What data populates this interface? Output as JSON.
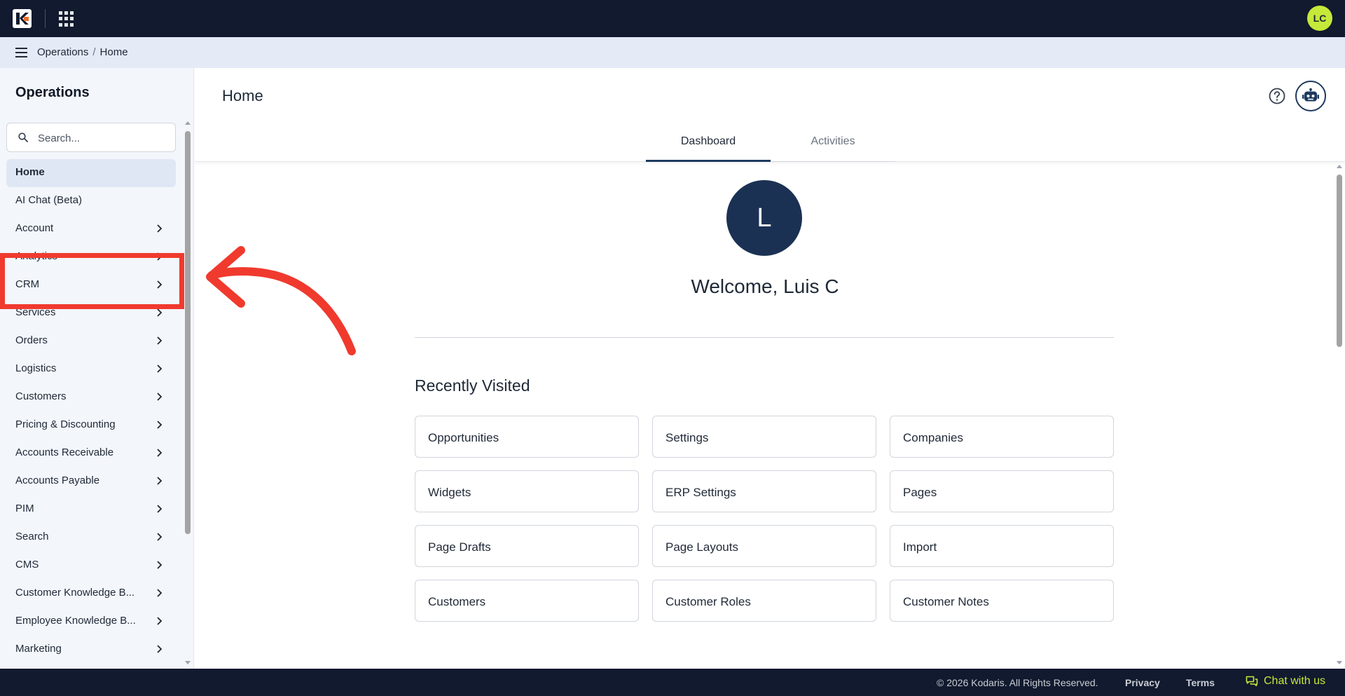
{
  "topbar": {
    "avatar_initials": "LC"
  },
  "breadcrumb": {
    "section": "Operations",
    "separator": "/",
    "current": "Home"
  },
  "sidebar": {
    "title": "Operations",
    "search_placeholder": "Search...",
    "items": [
      {
        "label": "Home",
        "active": true,
        "has_children": false
      },
      {
        "label": "AI Chat (Beta)",
        "has_children": false
      },
      {
        "label": "Account",
        "has_children": true
      },
      {
        "label": "Analytics",
        "has_children": true
      },
      {
        "label": "CRM",
        "has_children": true
      },
      {
        "label": "Services",
        "has_children": true
      },
      {
        "label": "Orders",
        "has_children": true
      },
      {
        "label": "Logistics",
        "has_children": true
      },
      {
        "label": "Customers",
        "has_children": true
      },
      {
        "label": "Pricing & Discounting",
        "has_children": true
      },
      {
        "label": "Accounts Receivable",
        "has_children": true
      },
      {
        "label": "Accounts Payable",
        "has_children": true
      },
      {
        "label": "PIM",
        "has_children": true
      },
      {
        "label": "Search",
        "has_children": true
      },
      {
        "label": "CMS",
        "has_children": true
      },
      {
        "label": "Customer Knowledge B...",
        "has_children": true
      },
      {
        "label": "Employee Knowledge B...",
        "has_children": true
      },
      {
        "label": "Marketing",
        "has_children": true
      }
    ]
  },
  "main": {
    "title": "Home",
    "tabs": [
      {
        "label": "Dashboard",
        "active": true
      },
      {
        "label": "Activities",
        "active": false
      }
    ],
    "user_initial": "L",
    "welcome": "Welcome, Luis C",
    "recent_title": "Recently Visited",
    "recent": [
      "Opportunities",
      "Settings",
      "Companies",
      "Widgets",
      "ERP Settings",
      "Pages",
      "Page Drafts",
      "Page Layouts",
      "Import",
      "Customers",
      "Customer Roles",
      "Customer Notes"
    ]
  },
  "footer": {
    "copyright": "© 2026 Kodaris. All Rights Reserved.",
    "privacy": "Privacy",
    "terms": "Terms",
    "chat": "Chat with us"
  },
  "colors": {
    "topbar": "#111a2e",
    "crumbbar": "#e4eaf6",
    "accent": "#1e3a5f",
    "avatar": "#c6e83a",
    "annotation": "#f03a2e"
  }
}
